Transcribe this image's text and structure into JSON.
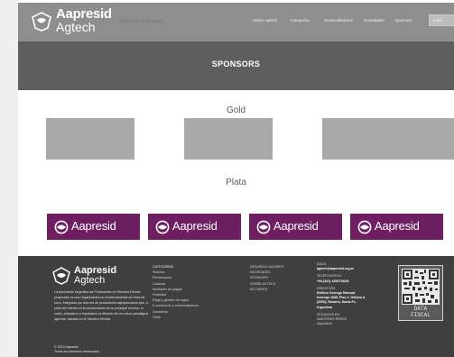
{
  "header": {
    "logo": {
      "line1": "Aapresid",
      "line2": "Agtech"
    },
    "search_placeholder": "¿Qué estás buscando?",
    "nav": [
      "Sobre Agtech",
      "Categorías",
      "Desarrolladores",
      "Novedades",
      "Sponsors"
    ],
    "nav_button": "Inicio"
  },
  "hero": {
    "title": "SPONSORS"
  },
  "gold": {
    "title": "Gold"
  },
  "plata": {
    "title": "Plata",
    "cards": [
      "Aapresid",
      "Aapresid",
      "Aapresid",
      "Aapresid"
    ]
  },
  "footer": {
    "logo": {
      "line1": "Aapresid",
      "line2": "Agtech"
    },
    "about": "La Asociación Argentina de Productores en Siembra Directa (Aapresid) es una Organización no Gubernamental sin fines de lucro, integrada por una red de productores agropecuarios que, a partir del interés en la conservación de su principal recurso, el suelo, adoptaron e impulsaron la difusión de un nuevo paradigma agrícola, basado en la Siembra Directa.",
    "copyright": [
      "© 2019 Aapresid",
      "Todos los derechos reservados"
    ],
    "categories": {
      "heading": "CATEGORÍAS",
      "items": [
        "Siembra",
        "Pulverización",
        "Cosecha",
        "Monitoreo de plagas",
        "Fertilidad",
        "Riego y gestión del agua",
        "E-commerce y comercialización",
        "Ganadería",
        "Otros"
      ]
    },
    "links": [
      "DESARROLLADORES",
      "NOVEDADES",
      "SPONSORS",
      "SOBRE AGTECH",
      "MI CUENTA"
    ],
    "contact": {
      "email_label": "EMAIL",
      "email": "agtech@aapresid.org.ar",
      "phone_label": "TELÉFONO/FAX",
      "phone": "+54 (341) 4260745/46",
      "address_label": "DIRECCIÓN",
      "address": [
        "Edificio Dorrego Ramsat",
        "Dorrego 1639, Piso 2, Oficina A",
        "(2000), Rosario, Santa Fe,",
        "Argentina"
      ],
      "social_label": "SEGUINOS EN",
      "social_sub": "NUESTRAS REDES",
      "social_handle": "/AapAtecH"
    },
    "qr_label": [
      "DATA",
      "FISCAL"
    ]
  }
}
